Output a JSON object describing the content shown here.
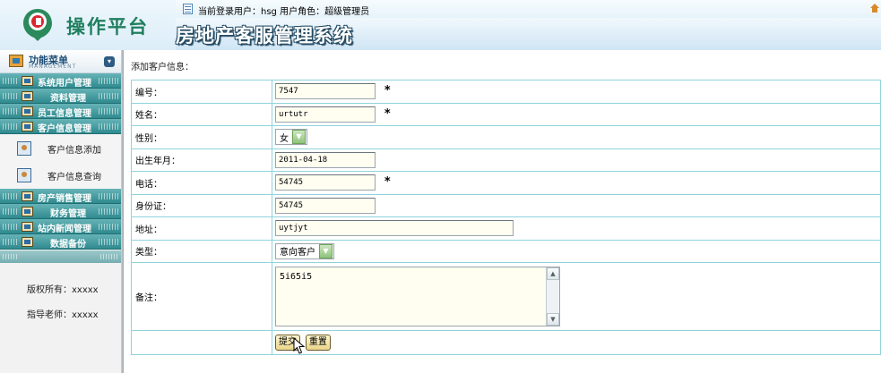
{
  "header": {
    "logo_text": "操作平台",
    "user_info": "当前登录用户：hsg   用户角色：超级管理员",
    "system_title": "房地产客服管理系统"
  },
  "sidebar": {
    "title": "功能菜单",
    "subtitle": "MANAGEMENT",
    "groups": [
      {
        "label": "系统用户管理"
      },
      {
        "label": "资料管理"
      },
      {
        "label": "员工信息管理"
      },
      {
        "label": "客户信息管理"
      }
    ],
    "sub_items": [
      {
        "label": "客户信息添加"
      },
      {
        "label": "客户信息查询"
      }
    ],
    "groups_after": [
      {
        "label": "房产销售管理"
      },
      {
        "label": "财务管理"
      },
      {
        "label": "站内新闻管理"
      },
      {
        "label": "数据备份"
      }
    ],
    "copyright": "版权所有：xxxxx",
    "advisor": "指导老师：xxxxx"
  },
  "main": {
    "heading": "添加客户信息：",
    "fields": {
      "id": {
        "label": "编号：",
        "value": "7547",
        "required": "*"
      },
      "name": {
        "label": "姓名：",
        "value": "urtutr",
        "required": "*"
      },
      "gender": {
        "label": "性别：",
        "value": "女"
      },
      "birth": {
        "label": "出生年月：",
        "value": "2011-04-18"
      },
      "phone": {
        "label": "电话：",
        "value": "54745",
        "required": "*"
      },
      "idcard": {
        "label": "身份证：",
        "value": "54745"
      },
      "address": {
        "label": "地址：",
        "value": "uytjyt"
      },
      "type": {
        "label": "类型：",
        "value": "意向客户"
      },
      "remark": {
        "label": "备注：",
        "value": "5i65i5"
      }
    },
    "submit_label": "提交",
    "reset_label": "重置"
  },
  "colors": {
    "accent_teal": "#2f8a8f",
    "table_border": "#8fd3dc",
    "title_outline": "#234a63"
  }
}
